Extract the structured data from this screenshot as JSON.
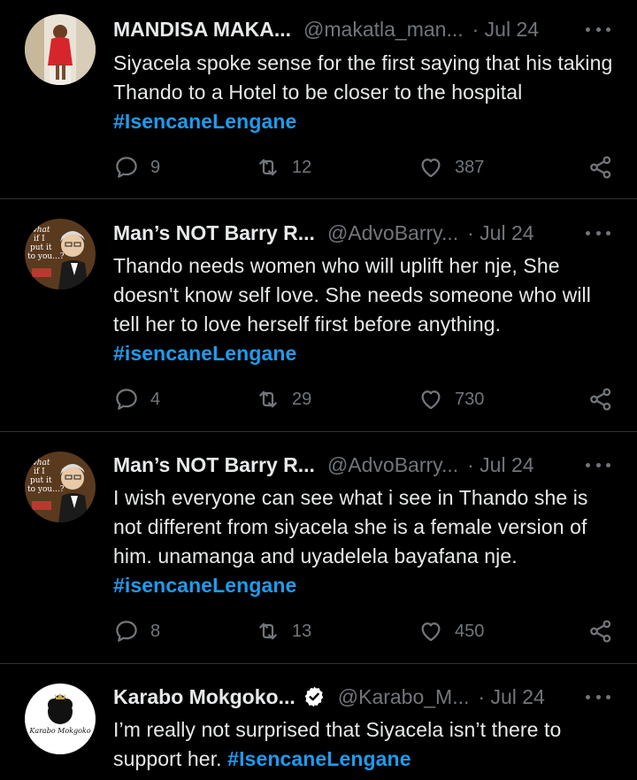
{
  "theme": {
    "background": "#000000",
    "text": "#e7e9ea",
    "muted": "#71767b",
    "accent": "#1d9bf0",
    "verified": "#ffffff"
  },
  "tweets": [
    {
      "name": "MANDISA MAKA...",
      "handle": "@makatla_man...",
      "date": "· Jul 24",
      "verified": false,
      "avatar_icon": "woman-red-jacket-avatar",
      "text": "Siyacela spoke sense for the first saying that his taking Thando to a Hotel to be closer to the hospital ",
      "hashtag": "#IsencaneLengane",
      "replies": "9",
      "retweets": "12",
      "likes": "387"
    },
    {
      "name": "Man’s NOT Barry R...",
      "handle": "@AdvoBarry...",
      "date": "· Jul 24",
      "verified": false,
      "avatar_icon": "cartoon-barry-avatar",
      "avatar_caption": "what if I put it to you...?",
      "text": "Thando needs women who will uplift her nje, She doesn't know self love. She needs someone who will tell her to love herself first before anything. ",
      "hashtag": "#isencaneLengane",
      "replies": "4",
      "retweets": "29",
      "likes": "730"
    },
    {
      "name": "Man’s NOT Barry R...",
      "handle": "@AdvoBarry...",
      "date": "· Jul 24",
      "verified": false,
      "avatar_icon": "cartoon-barry-avatar",
      "avatar_caption": "what if I put it to you...?",
      "text": "I wish everyone can see what i see in Thando she is not different from siyacela she is a female version of him. unamanga and uyadelela bayafana nje. ",
      "hashtag": "#isencaneLengane",
      "replies": "8",
      "retweets": "13",
      "likes": "450"
    },
    {
      "name": "Karabo Mokgoko...",
      "handle": "@Karabo_M...",
      "date": "· Jul 24",
      "verified": true,
      "avatar_icon": "karabo-mokgoko-logo-avatar",
      "avatar_caption": "Karabo Mokgoko",
      "text": "I’m really not surprised that Siyacela isn’t there to support her. ",
      "hashtag": "#IsencaneLengane"
    }
  ]
}
